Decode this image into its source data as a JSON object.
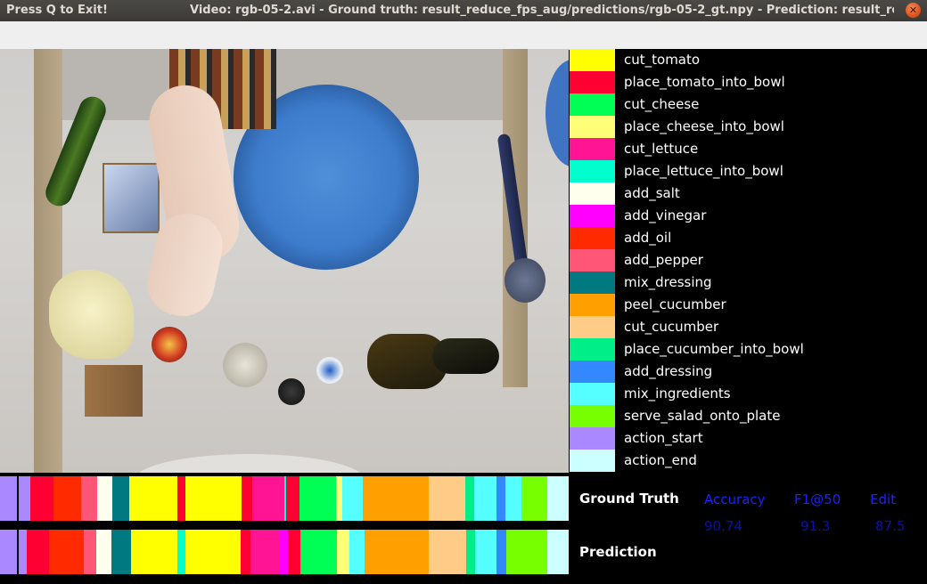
{
  "window": {
    "left_text": "Press Q to Exit!",
    "title": "Video: rgb-05-2.avi - Ground truth: result_reduce_fps_aug/predictions/rgb-05-2_gt.npy - Prediction: result_re..."
  },
  "legend": [
    {
      "label": "cut_tomato",
      "color": "#ffff00"
    },
    {
      "label": "place_tomato_into_bowl",
      "color": "#ff0033"
    },
    {
      "label": "cut_cheese",
      "color": "#00ff55"
    },
    {
      "label": "place_cheese_into_bowl",
      "color": "#ffff77"
    },
    {
      "label": "cut_lettuce",
      "color": "#ff1493"
    },
    {
      "label": "place_lettuce_into_bowl",
      "color": "#00ffcc"
    },
    {
      "label": "add_salt",
      "color": "#ffffee"
    },
    {
      "label": "add_vinegar",
      "color": "#ff00ff"
    },
    {
      "label": "add_oil",
      "color": "#ff2a00"
    },
    {
      "label": "add_pepper",
      "color": "#ff5577"
    },
    {
      "label": "mix_dressing",
      "color": "#007a80"
    },
    {
      "label": "peel_cucumber",
      "color": "#ffa000"
    },
    {
      "label": "cut_cucumber",
      "color": "#ffcc88"
    },
    {
      "label": "place_cucumber_into_bowl",
      "color": "#00ee88"
    },
    {
      "label": "add_dressing",
      "color": "#3388ff"
    },
    {
      "label": "mix_ingredients",
      "color": "#55ffff"
    },
    {
      "label": "serve_salad_onto_plate",
      "color": "#77ff00"
    },
    {
      "label": "action_start",
      "color": "#aa88ff"
    },
    {
      "label": "action_end",
      "color": "#ccffff"
    }
  ],
  "ground_truth_segments": [
    {
      "action": "action_start",
      "frac": 0.053
    },
    {
      "action": "place_tomato_into_bowl",
      "frac": 0.041
    },
    {
      "action": "add_oil",
      "frac": 0.048
    },
    {
      "action": "add_pepper",
      "frac": 0.028
    },
    {
      "action": "add_salt",
      "frac": 0.026
    },
    {
      "action": "mix_dressing",
      "frac": 0.03
    },
    {
      "action": "cut_tomato",
      "frac": 0.085
    },
    {
      "action": "place_tomato_into_bowl",
      "frac": 0.013
    },
    {
      "action": "cut_tomato",
      "frac": 0.099
    },
    {
      "action": "place_tomato_into_bowl",
      "frac": 0.019
    },
    {
      "action": "cut_lettuce",
      "frac": 0.055
    },
    {
      "action": "place_lettuce_into_bowl",
      "frac": 0.003
    },
    {
      "action": "place_tomato_into_bowl",
      "frac": 0.024
    },
    {
      "action": "cut_cheese",
      "frac": 0.064
    },
    {
      "action": "place_cheese_into_bowl",
      "frac": 0.011
    },
    {
      "action": "mix_ingredients",
      "frac": 0.036
    },
    {
      "action": "peel_cucumber",
      "frac": 0.115
    },
    {
      "action": "cut_cucumber",
      "frac": 0.064
    },
    {
      "action": "place_cucumber_into_bowl",
      "frac": 0.016
    },
    {
      "action": "mix_ingredients",
      "frac": 0.038
    },
    {
      "action": "add_dressing",
      "frac": 0.016
    },
    {
      "action": "mix_ingredients",
      "frac": 0.028
    },
    {
      "action": "serve_salad_onto_plate",
      "frac": 0.045
    },
    {
      "action": "action_end",
      "frac": 0.038
    }
  ],
  "prediction_segments": [
    {
      "action": "action_start",
      "frac": 0.047
    },
    {
      "action": "place_tomato_into_bowl",
      "frac": 0.039
    },
    {
      "action": "add_oil",
      "frac": 0.061
    },
    {
      "action": "add_pepper",
      "frac": 0.022
    },
    {
      "action": "add_salt",
      "frac": 0.027
    },
    {
      "action": "mix_dressing",
      "frac": 0.033
    },
    {
      "action": "cut_tomato",
      "frac": 0.082
    },
    {
      "action": "place_lettuce_into_bowl",
      "frac": 0.014
    },
    {
      "action": "cut_tomato",
      "frac": 0.097
    },
    {
      "action": "place_tomato_into_bowl",
      "frac": 0.017
    },
    {
      "action": "cut_lettuce",
      "frac": 0.052
    },
    {
      "action": "add_vinegar",
      "frac": 0.014
    },
    {
      "action": "place_tomato_into_bowl",
      "frac": 0.022
    },
    {
      "action": "cut_cheese",
      "frac": 0.063
    },
    {
      "action": "place_cheese_into_bowl",
      "frac": 0.022
    },
    {
      "action": "mix_ingredients",
      "frac": 0.027
    },
    {
      "action": "peel_cucumber",
      "frac": 0.113
    },
    {
      "action": "cut_cucumber",
      "frac": 0.065
    },
    {
      "action": "place_cucumber_into_bowl",
      "frac": 0.016
    },
    {
      "action": "mix_ingredients",
      "frac": 0.038
    },
    {
      "action": "add_dressing",
      "frac": 0.016
    },
    {
      "action": "serve_salad_onto_plate",
      "frac": 0.072
    },
    {
      "action": "action_end",
      "frac": 0.038
    }
  ],
  "playhead_frac": 0.029,
  "metrics": {
    "gt_label": "Ground Truth",
    "pred_label": "Prediction",
    "headers": {
      "accuracy": "Accuracy",
      "f1": "F1@50",
      "edit": "Edit"
    },
    "values": {
      "accuracy": "90.74",
      "f1": "91.3",
      "edit": "87.5"
    },
    "metric_color": "#1a22ff",
    "value_color": "#0a10b0"
  }
}
